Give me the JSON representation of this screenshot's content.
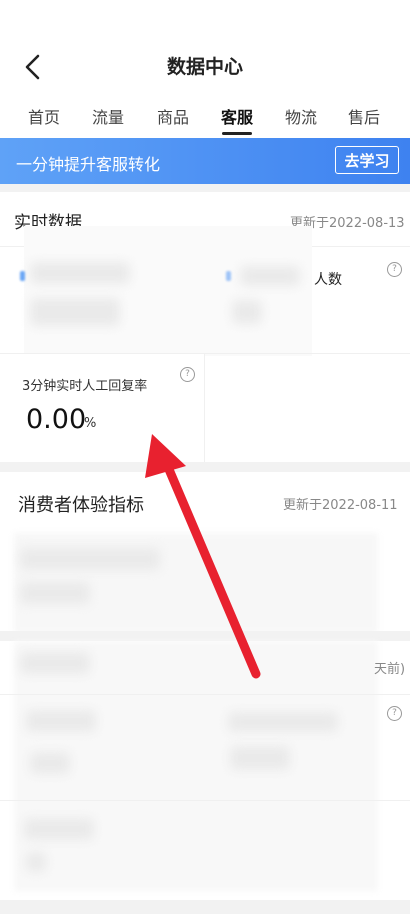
{
  "header": {
    "title": "数据中心",
    "back_icon": "chevron-left-icon"
  },
  "tabs": [
    {
      "label": "首页"
    },
    {
      "label": "流量"
    },
    {
      "label": "商品"
    },
    {
      "label": "客服",
      "active": true
    },
    {
      "label": "物流"
    },
    {
      "label": "售后"
    }
  ],
  "banner": {
    "text": "一分钟提升客服转化",
    "button": "去学习",
    "color": "#4a8ff4"
  },
  "realtime": {
    "title": "实时数据",
    "updated": "更新于2022-08-13",
    "partial_label_1": "人数"
  },
  "card": {
    "label": "3分钟实时人工回复率",
    "value": "0.00",
    "unit": "%"
  },
  "experience": {
    "title": "消费者体验指标",
    "updated": "更新于2022-08-11"
  },
  "section3": {
    "partial_date": "天前)"
  },
  "annotation": {
    "arrow_color": "#e8212f"
  }
}
